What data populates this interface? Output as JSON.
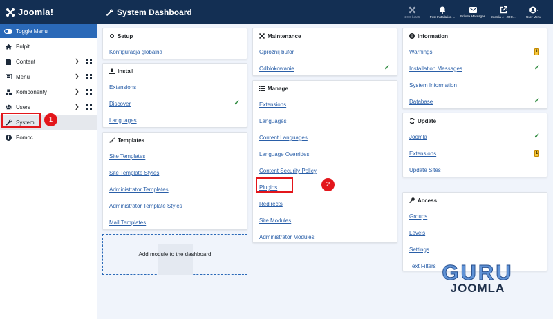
{
  "header": {
    "logo_text": "Joomla!",
    "title": "System Dashboard",
    "items": [
      {
        "icon": "joomla-logo-icon",
        "label": "4.0.0-beta5"
      },
      {
        "icon": "bell-icon",
        "label": "Post Installation ..."
      },
      {
        "icon": "envelope-icon",
        "label": "Private Messages"
      },
      {
        "icon": "external-link-icon",
        "label": "Joomla 4 - JOO..."
      },
      {
        "icon": "user-circle-icon",
        "label": "User Menu"
      }
    ]
  },
  "sidebar": {
    "toggle_label": "Toggle Menu",
    "items": [
      {
        "label": "Pulpit",
        "icon": "home-icon"
      },
      {
        "label": "Content",
        "icon": "file-icon"
      },
      {
        "label": "Menu",
        "icon": "list-icon"
      },
      {
        "label": "Komponenty",
        "icon": "cubes-icon"
      },
      {
        "label": "Users",
        "icon": "users-icon"
      },
      {
        "label": "System",
        "icon": "wrench-icon"
      },
      {
        "label": "Pomoc",
        "icon": "info-circle-icon"
      }
    ]
  },
  "cards": {
    "setup": {
      "title": "Setup",
      "links": [
        "Konfiguracja globalna"
      ]
    },
    "install": {
      "title": "Install",
      "links": [
        "Extensions",
        "Discover",
        "Languages"
      ]
    },
    "templates": {
      "title": "Templates",
      "links": [
        "Site Templates",
        "Site Template Styles",
        "Administrator Templates",
        "Administrator Template Styles",
        "Mail Templates"
      ]
    },
    "add_module": "Add module to the dashboard",
    "maintenance": {
      "title": "Maintenance",
      "links": [
        "Opróżnij bufor",
        "Odblokowanie"
      ]
    },
    "manage": {
      "title": "Manage",
      "links": [
        "Extensions",
        "Languages",
        "Content Languages",
        "Language Overrides",
        "Content Security Policy",
        "Plugins",
        "Redirects",
        "Site Modules",
        "Administrator Modules"
      ]
    },
    "information": {
      "title": "Information",
      "links": [
        "Warnings",
        "Installation Messages",
        "System Information",
        "Database"
      ],
      "warnings_badge": "1"
    },
    "update": {
      "title": "Update",
      "links": [
        "Joomla",
        "Extensions",
        "Update Sites"
      ],
      "extensions_badge": "1"
    },
    "access": {
      "title": "Access",
      "links": [
        "Groups",
        "Levels",
        "Settings",
        "Text Filters"
      ]
    }
  },
  "callouts": [
    "1",
    "2"
  ],
  "watermark": {
    "line1": "GURU",
    "line2": "JOOMLA"
  },
  "colors": {
    "header_bg": "#132f53",
    "accent": "#2a69b8",
    "link": "#2a5fa8",
    "success": "#2d8a3e",
    "highlight": "#e3161b",
    "warning": "#f5c73d"
  }
}
